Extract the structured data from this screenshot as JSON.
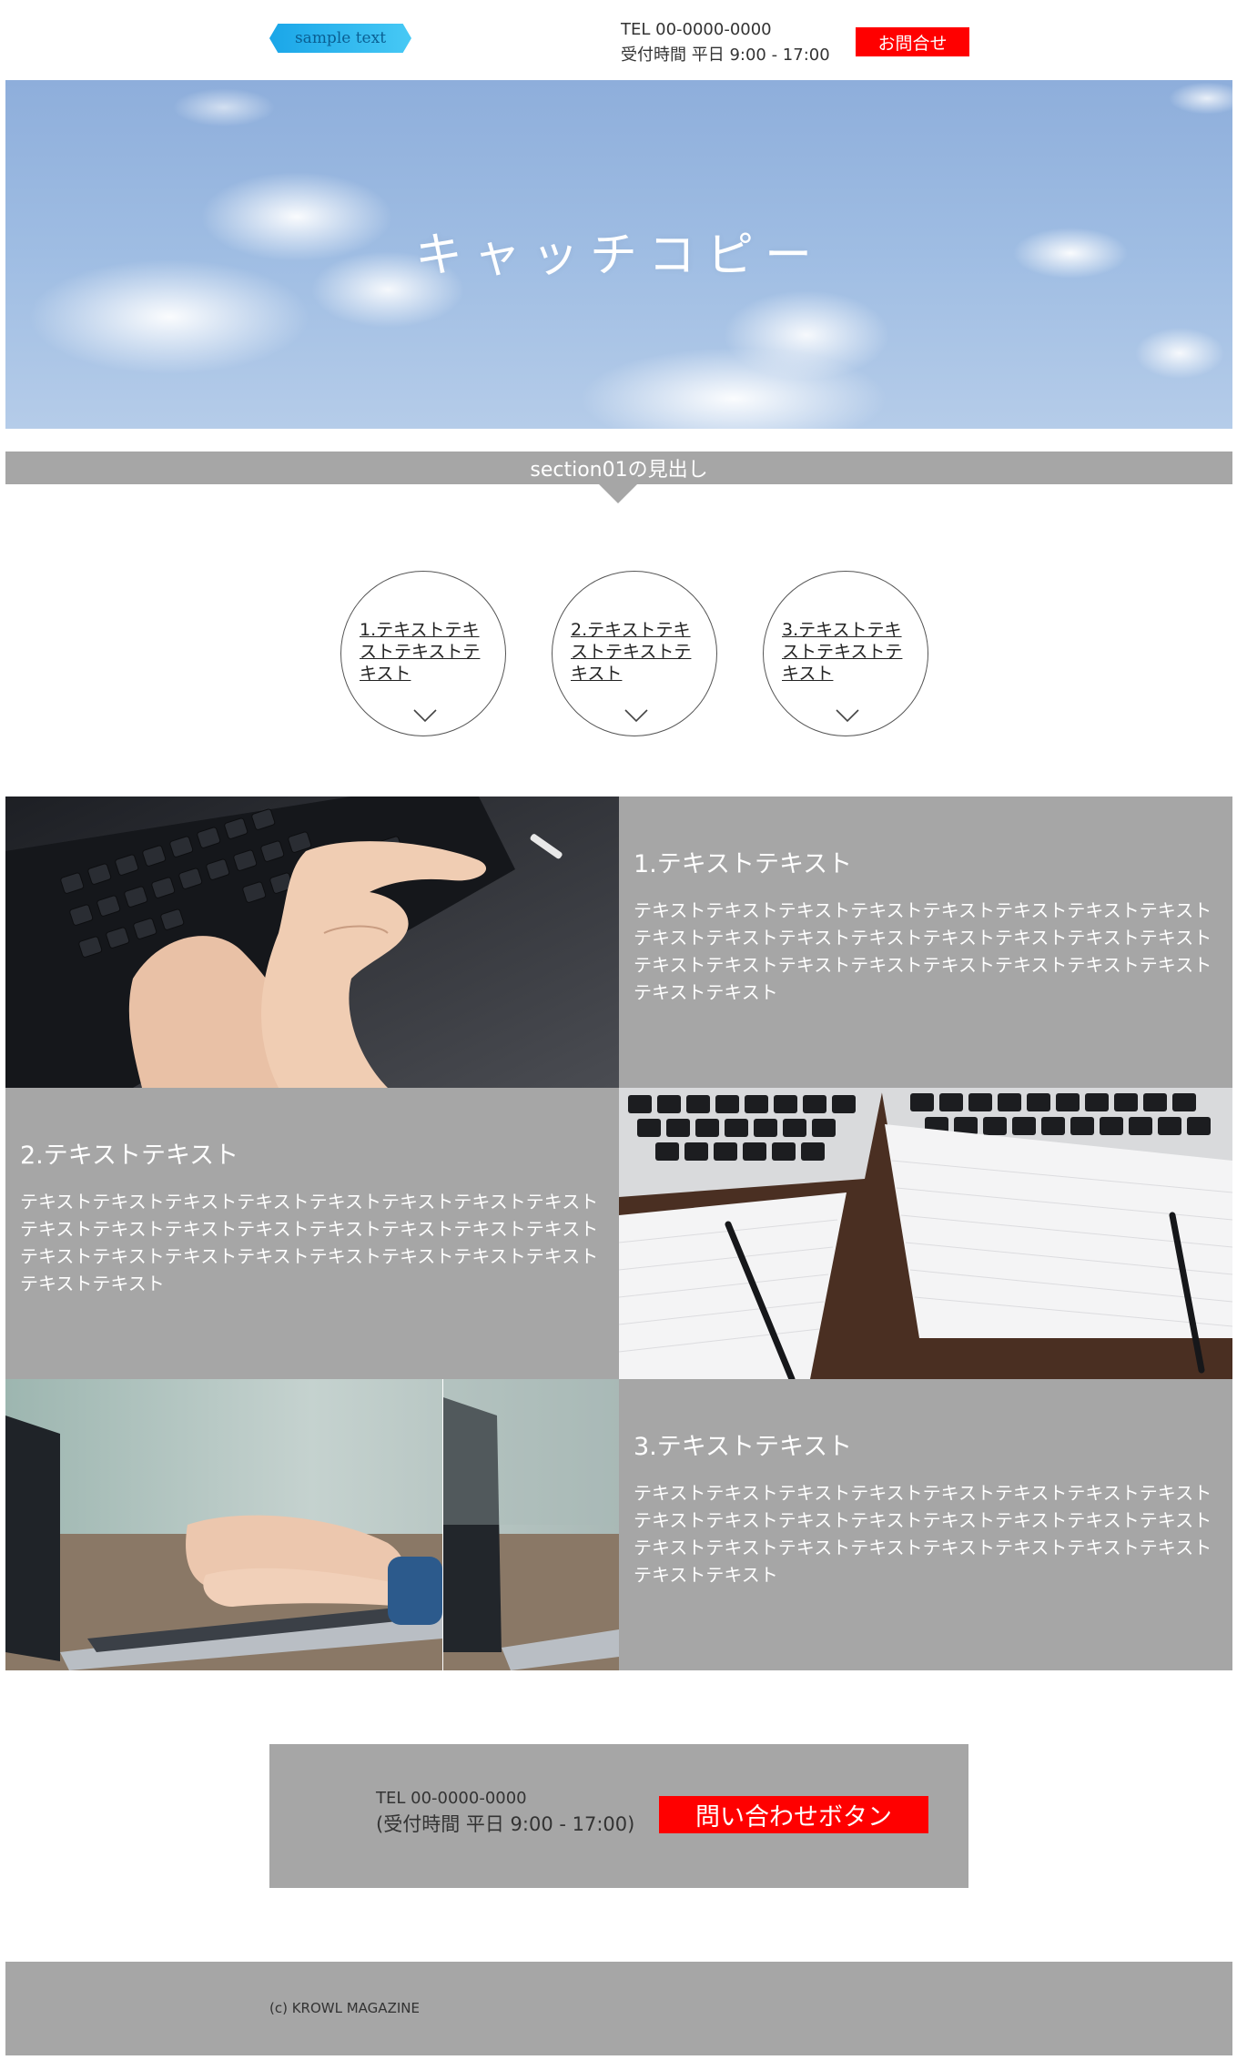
{
  "header": {
    "logo_text": "sample text",
    "tel": "TEL 00-0000-0000",
    "hours": "受付時間 平日 9:00 - 17:00",
    "contact_button": "お問合せ"
  },
  "hero": {
    "catch_copy": "キャッチコピー"
  },
  "section01": {
    "heading": "section01の見出し",
    "circles": [
      {
        "label": "1.テキストテキストテキストテキスト"
      },
      {
        "label": "2.テキストテキストテキストテキスト"
      },
      {
        "label": "3.テキストテキストテキストテキスト"
      }
    ],
    "features": [
      {
        "title": "1.テキストテキスト",
        "body": "テキストテキストテキストテキストテキストテキストテキストテキストテキストテキストテキストテキストテキストテキストテキストテキストテキストテキストテキストテキストテキストテキストテキストテキストテキストテキスト"
      },
      {
        "title": "2.テキストテキスト",
        "body": "テキストテキストテキストテキストテキストテキストテキストテキストテキストテキストテキストテキストテキストテキストテキストテキストテキストテキストテキストテキストテキストテキストテキストテキストテキストテキスト"
      },
      {
        "title": "3.テキストテキスト",
        "body": "テキストテキストテキストテキストテキストテキストテキストテキストテキストテキストテキストテキストテキストテキストテキストテキストテキストテキストテキストテキストテキストテキストテキストテキストテキストテキスト"
      }
    ]
  },
  "contact": {
    "tel": "TEL 00-0000-0000",
    "hours": "(受付時間 平日 9:00 - 17:00)",
    "button": "問い合わせボタン"
  },
  "footer": {
    "copyright": "(c) KROWL MAGAZINE"
  },
  "colors": {
    "accent_red": "#ff0000",
    "panel_gray": "#a6a6a6",
    "logo_blue": "#1aa6e8"
  },
  "icons": {
    "circle_chevron": "chevron-down-icon"
  }
}
